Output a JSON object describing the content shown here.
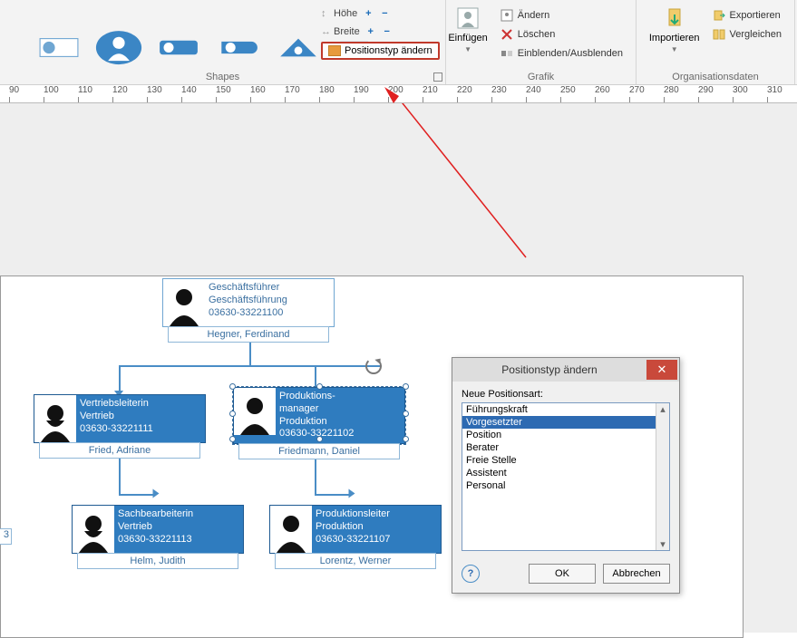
{
  "ribbon": {
    "groups": {
      "shapes": "Shapes",
      "grafik": "Grafik",
      "orgdata": "Organisationsdaten"
    },
    "height": "Höhe",
    "width": "Breite",
    "positionstyp": "Positionstyp ändern",
    "insert": "Einfügen",
    "aendern": "Ändern",
    "loeschen": "Löschen",
    "einblenden": "Einblenden/Ausblenden",
    "importieren": "Importieren",
    "exportieren": "Exportieren",
    "vergleichen": "Vergleichen"
  },
  "ruler": [
    90,
    100,
    110,
    120,
    130,
    140,
    150,
    160,
    170,
    180,
    190,
    200,
    210,
    220,
    230,
    240,
    250,
    260,
    270,
    280,
    290,
    300,
    310
  ],
  "org": {
    "top": {
      "title": "Geschäftsführer",
      "dept": "Geschäftsführung",
      "phone": "03630-33221100",
      "name": "Hegner, Ferdinand"
    },
    "n1": {
      "title": "Vertriebsleiterin",
      "dept": "Vertrieb",
      "phone": "03630-33221111",
      "name": "Fried, Adriane"
    },
    "n2": {
      "title": "Produktions-\nmanager",
      "dept": "Produktion",
      "phone": "03630-33221102",
      "name": "Friedmann, Daniel"
    },
    "n3": {
      "title": "Sachbearbeiterin",
      "dept": "Vertrieb",
      "phone": "03630-33221113",
      "name": "Helm, Judith"
    },
    "n4": {
      "title": "Produktionsleiter",
      "dept": "Produktion",
      "phone": "03630-33221107",
      "name": "Lorentz, Werner"
    }
  },
  "dialog": {
    "title": "Positionstyp ändern",
    "label": "Neue Positionsart:",
    "options": [
      "Führungskraft",
      "Vorgesetzter",
      "Position",
      "Berater",
      "Freie Stelle",
      "Assistent",
      "Personal"
    ],
    "ok": "OK",
    "cancel": "Abbrechen"
  }
}
